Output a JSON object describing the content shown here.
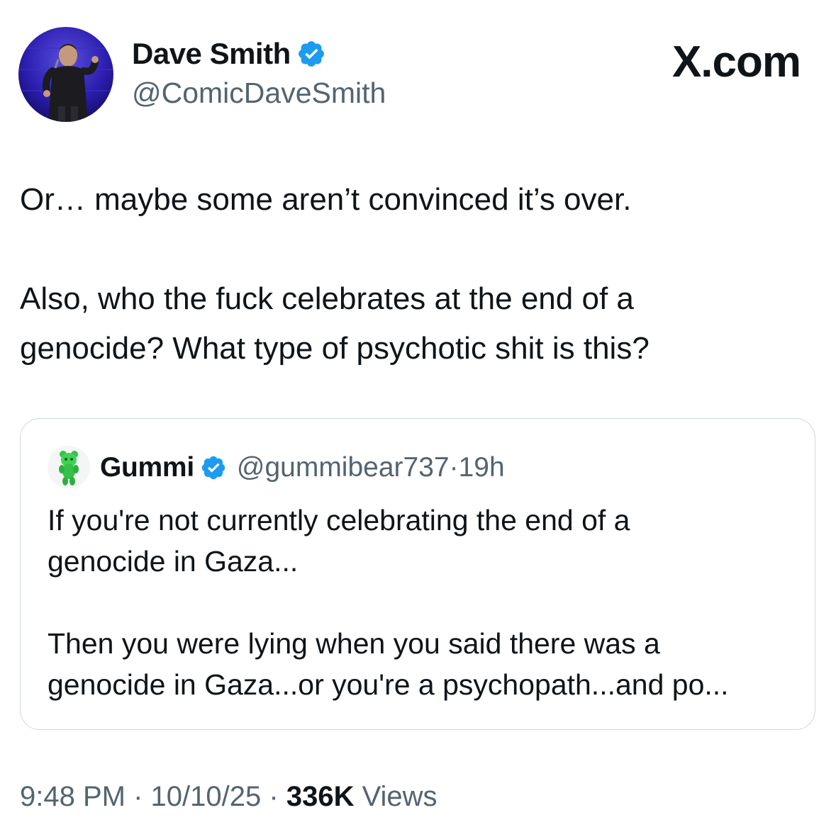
{
  "header": {
    "display_name": "Dave Smith",
    "handle": "@ComicDaveSmith",
    "brand": "X.com",
    "verified_color": "#1d9bf0"
  },
  "tweet": {
    "lines": [
      "Or… maybe some aren’t convinced it’s over.",
      "",
      "Also, who the fuck celebrates at the end of a",
      "genocide? What type of psychotic shit is this?"
    ]
  },
  "quote": {
    "name": "Gummi",
    "handle": "@gummibear737",
    "separator": "·",
    "time": "19h",
    "lines": [
      "If you're not currently celebrating the end of a",
      "genocide in Gaza...",
      "",
      "Then you were lying when you said there was a",
      "genocide in Gaza...or you're a psychopath...and po..."
    ]
  },
  "footer": {
    "time": "9:48 PM",
    "separator": "·",
    "date": "10/10/25",
    "views_count": "336K",
    "views_label": "Views"
  }
}
